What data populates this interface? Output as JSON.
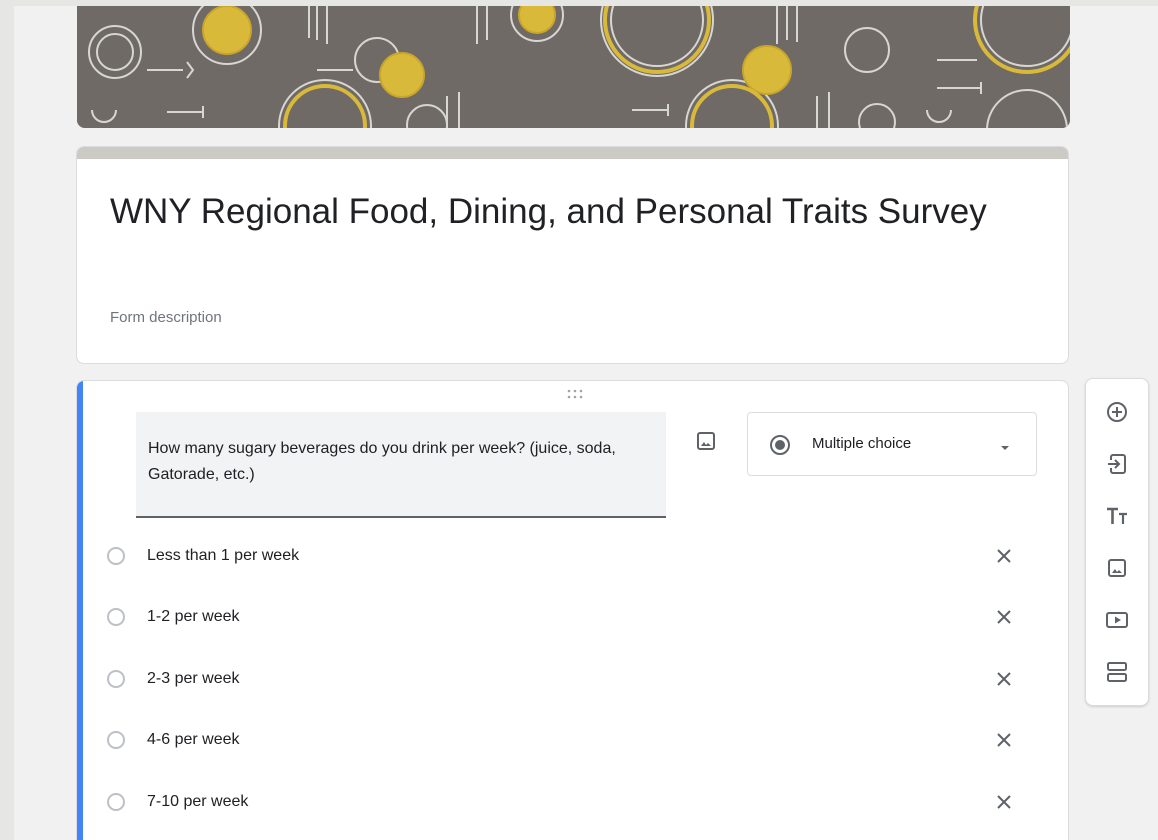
{
  "form": {
    "title": "WNY Regional Food, Dining, and Personal Traits Survey",
    "description_placeholder": "Form description"
  },
  "question": {
    "text": "How many sugary beverages do you drink per week? (juice, soda, Gatorade, etc.)",
    "type_selected": "Multiple choice",
    "options": [
      {
        "label": "Less than 1 per week"
      },
      {
        "label": "1-2 per week"
      },
      {
        "label": "2-3 per week"
      },
      {
        "label": "4-6 per week"
      },
      {
        "label": "7-10 per week"
      }
    ]
  },
  "toolbar": {
    "items": [
      {
        "icon": "add-question-icon"
      },
      {
        "icon": "import-questions-icon"
      },
      {
        "icon": "add-title-description-icon"
      },
      {
        "icon": "add-image-icon"
      },
      {
        "icon": "add-video-icon"
      },
      {
        "icon": "add-section-icon"
      }
    ]
  },
  "colors": {
    "accent": "#4285f4",
    "header_bar": "#cbcac5",
    "banner_bg": "#6f6a66",
    "banner_gold": "#d9b93a"
  }
}
